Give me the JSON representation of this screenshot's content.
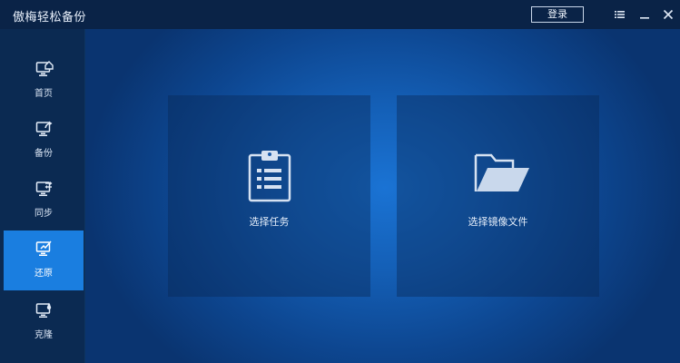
{
  "app": {
    "title": "傲梅轻松备份",
    "login_label": "登录"
  },
  "titlebar_icons": [
    "menu-icon",
    "minimize-icon",
    "close-icon"
  ],
  "sidebar": {
    "items": [
      {
        "label": "首页",
        "icon": "home-monitor-icon",
        "active": false
      },
      {
        "label": "备份",
        "icon": "backup-monitor-icon",
        "active": false
      },
      {
        "label": "同步",
        "icon": "sync-monitor-icon",
        "active": false
      },
      {
        "label": "还原",
        "icon": "restore-monitor-icon",
        "active": true
      },
      {
        "label": "克隆",
        "icon": "clone-monitor-icon",
        "active": false
      }
    ]
  },
  "main": {
    "cards": [
      {
        "label": "选择任务",
        "icon": "clipboard-list-icon"
      },
      {
        "label": "选择镜像文件",
        "icon": "folder-open-icon"
      }
    ]
  },
  "colors": {
    "accent": "#1a7ee0",
    "titlebar": "#0a2347",
    "sidebar": "#0b2a52",
    "main_center": "#1a73d4",
    "main_edge": "#0a3470"
  }
}
